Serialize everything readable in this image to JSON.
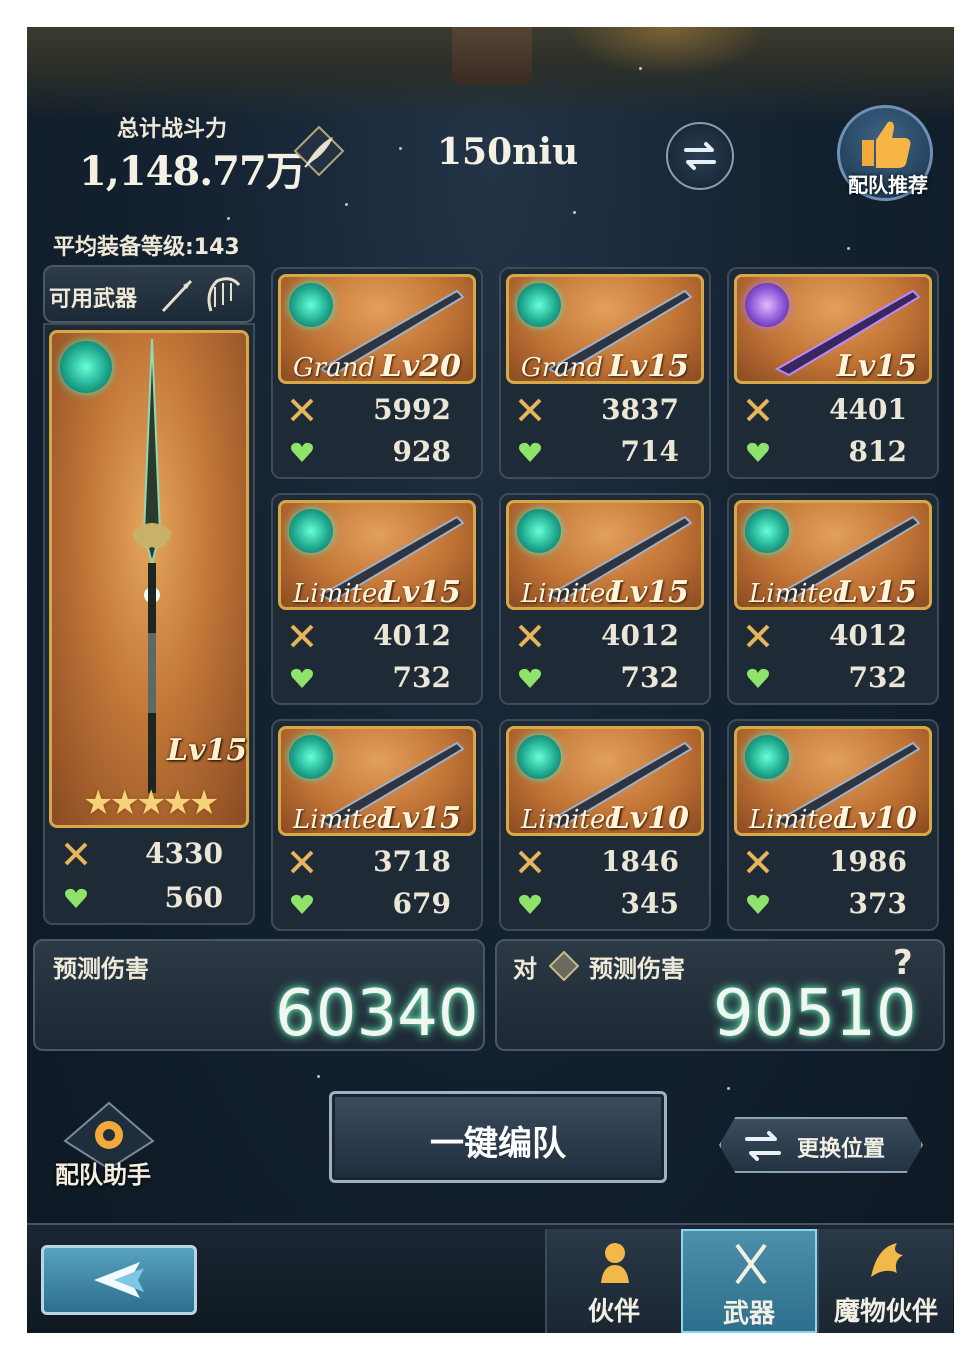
{
  "header": {
    "power_label": "总计战斗力",
    "power_value": "1,148.77万",
    "player_name": "150niu",
    "recommend_label": "配队推荐"
  },
  "avg_level": "平均装备等级:143",
  "available_label": "可用武器",
  "main_weapon": {
    "element_icon": "wind-element-icon",
    "level": "Lv15",
    "stars": "★★★★★",
    "atk": "4330",
    "hp": "560"
  },
  "weapons": [
    {
      "rarity": "Grand",
      "level": "Lv20",
      "atk": "5992",
      "hp": "928",
      "element": "wind"
    },
    {
      "rarity": "Grand",
      "level": "Lv15",
      "atk": "3837",
      "hp": "714",
      "element": "wind"
    },
    {
      "rarity": "",
      "level": "Lv15",
      "atk": "4401",
      "hp": "812",
      "element": "dark"
    },
    {
      "rarity": "Limited",
      "level": "Lv15",
      "atk": "4012",
      "hp": "732",
      "element": "wind"
    },
    {
      "rarity": "Limited",
      "level": "Lv15",
      "atk": "4012",
      "hp": "732",
      "element": "wind"
    },
    {
      "rarity": "Limited",
      "level": "Lv15",
      "atk": "4012",
      "hp": "732",
      "element": "wind"
    },
    {
      "rarity": "Limited",
      "level": "Lv15",
      "atk": "3718",
      "hp": "679",
      "element": "wind"
    },
    {
      "rarity": "Limited",
      "level": "Lv10",
      "atk": "1846",
      "hp": "345",
      "element": "wind"
    },
    {
      "rarity": "Limited",
      "level": "Lv10",
      "atk": "1986",
      "hp": "373",
      "element": "wind"
    }
  ],
  "damage": {
    "left_title": "预测伤害",
    "left_value": "60340",
    "right_prefix": "对",
    "right_title": "预测伤害",
    "right_value": "90510",
    "help": "?"
  },
  "controls": {
    "assist_label": "配队助手",
    "auto_label": "一键编队",
    "swap_label": "更换位置"
  },
  "nav": {
    "tabs": [
      {
        "label": "伙伴",
        "active": false
      },
      {
        "label": "武器",
        "active": true
      },
      {
        "label": "魔物伙伴",
        "active": false
      }
    ]
  },
  "colors": {
    "gold_frame": "#d5a94a",
    "wind": "#1fa98f",
    "dark": "#8a53d4",
    "damage_glow": "#6fe8b5"
  }
}
